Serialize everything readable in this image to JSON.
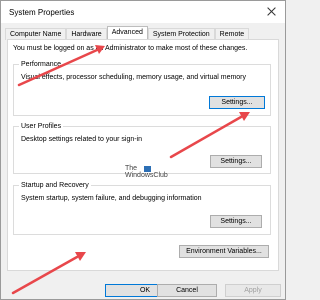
{
  "window": {
    "title": "System Properties"
  },
  "tabs": [
    {
      "label": "Computer Name"
    },
    {
      "label": "Hardware"
    },
    {
      "label": "Advanced"
    },
    {
      "label": "System Protection"
    },
    {
      "label": "Remote"
    }
  ],
  "active_tab": "Advanced",
  "admin_note": "You must be logged on as an Administrator to make most of these changes.",
  "performance": {
    "title": "Performance",
    "description": "Visual effects, processor scheduling, memory usage, and virtual memory",
    "settings_label": "Settings..."
  },
  "user_profiles": {
    "title": "User Profiles",
    "description": "Desktop settings related to your sign-in",
    "settings_label": "Settings..."
  },
  "startup_recovery": {
    "title": "Startup and Recovery",
    "description": "System startup, system failure, and debugging information",
    "settings_label": "Settings..."
  },
  "environment_variables_label": "Environment Variables...",
  "watermark": {
    "line1": "The",
    "line2": "WindowsClub"
  },
  "footer": {
    "ok_label": "OK",
    "cancel_label": "Cancel",
    "apply_label": "Apply"
  },
  "colors": {
    "arrow": "#e8474b",
    "focus_border": "#0078d7",
    "button_face": "#e1e1e1"
  },
  "annotations": {
    "arrow_count": 3
  }
}
